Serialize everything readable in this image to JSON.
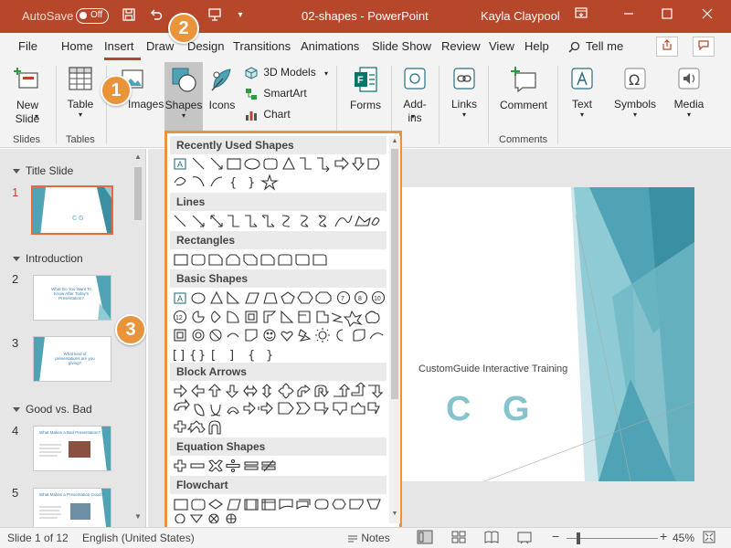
{
  "titlebar": {
    "autosave_label": "AutoSave",
    "autosave_state": "Off",
    "doc_title": "02-shapes - PowerPoint",
    "user": "Kayla Claypool"
  },
  "tabs": [
    "File",
    "Home",
    "Insert",
    "Draw",
    "Design",
    "Transitions",
    "Animations",
    "Slide Show",
    "Review",
    "View",
    "Help"
  ],
  "active_tab": "Insert",
  "tell_me": "Tell me",
  "ribbon": {
    "new_slide": "New Slide",
    "table": "Table",
    "images": "Images",
    "shapes": "Shapes",
    "icons": "Icons",
    "models3d": "3D Models",
    "smartart": "SmartArt",
    "chart": "Chart",
    "forms": "Forms",
    "addins": "Add-ins",
    "links": "Links",
    "comment": "Comment",
    "text": "Text",
    "symbols": "Symbols",
    "media": "Media",
    "groups": {
      "slides": "Slides",
      "tables": "Tables",
      "comments": "Comments"
    }
  },
  "dropdown": {
    "categories": [
      "Recently Used Shapes",
      "Lines",
      "Rectangles",
      "Basic Shapes",
      "Block Arrows",
      "Equation Shapes",
      "Flowchart"
    ]
  },
  "slides_pane": {
    "sections": [
      "Title Slide",
      "Introduction",
      "Good vs. Bad"
    ],
    "slide_numbers": [
      "1",
      "2",
      "3",
      "4",
      "5"
    ],
    "thumb_texts": {
      "s1": "C G",
      "s2": "What Do You Want To Know After Today's Presentation?",
      "s3": "What kind of presentations are you giving?",
      "s4": "What Makes a Bad Presentation?",
      "s5": "What Makes a Presentation Good?"
    }
  },
  "slide": {
    "subtitle": "CustomGuide Interactive Training",
    "logo": "C G"
  },
  "statusbar": {
    "slide_info": "Slide 1 of 12",
    "language": "English (United States)",
    "notes": "Notes",
    "zoom": "45%"
  },
  "callouts": [
    "1",
    "2",
    "3"
  ],
  "colors": {
    "accent": "#b7472a",
    "callout": "#e9943b",
    "teal": "#4fa3b5"
  }
}
